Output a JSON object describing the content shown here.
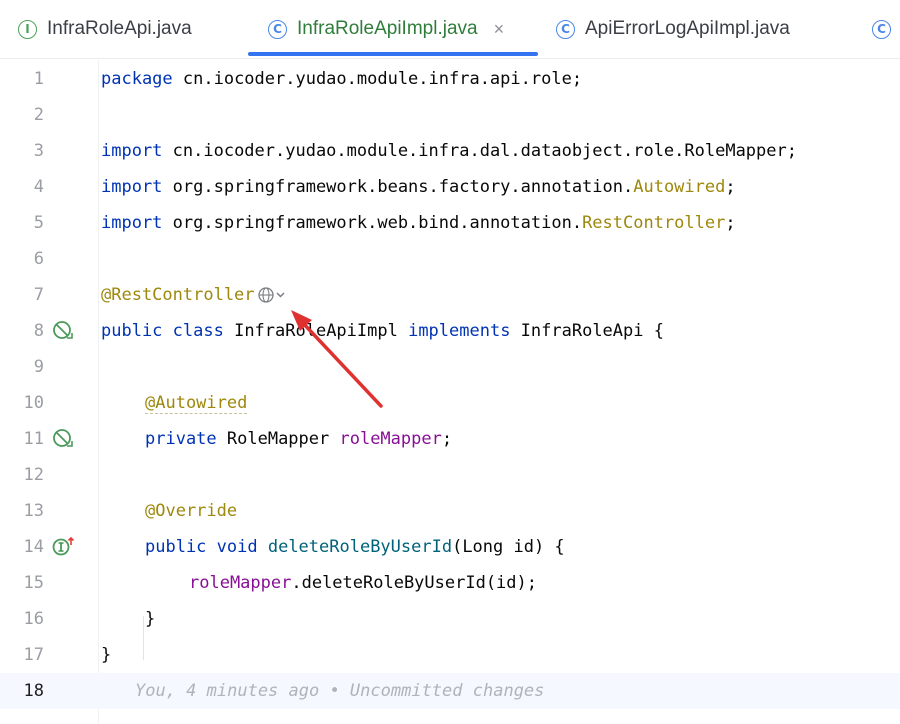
{
  "tabs": [
    {
      "label": "InfraRoleApi.java",
      "icon": "interface-icon",
      "icon_glyph": "I",
      "active": false
    },
    {
      "label": "InfraRoleApiImpl.java",
      "icon": "class-icon",
      "icon_glyph": "C",
      "active": true,
      "close": "×"
    },
    {
      "label": "ApiErrorLogApiImpl.java",
      "icon": "class-icon",
      "icon_glyph": "C",
      "active": false
    },
    {
      "label": "",
      "icon": "class-icon",
      "icon_glyph": "C",
      "active": false
    }
  ],
  "colors": {
    "keyword": "#0033b3",
    "annotation": "#9e880d",
    "field": "#871094",
    "method": "#00627a",
    "accent": "#3574f0"
  },
  "editor": {
    "line_numbers": [
      "1",
      "2",
      "3",
      "4",
      "5",
      "6",
      "7",
      "8",
      "9",
      "10",
      "11",
      "12",
      "13",
      "14",
      "15",
      "16",
      "17",
      "18"
    ],
    "current_line": "18",
    "lines": {
      "l1_kw": "package",
      "l1_rest": " cn.iocoder.yudao.module.infra.api.role;",
      "l3_kw": "import",
      "l3_rest": " cn.iocoder.yudao.module.infra.dal.dataobject.role.RoleMapper;",
      "l4_kw": "import",
      "l4_rest": " org.springframework.beans.factory.annotation.",
      "l4_ann": "Autowired",
      "l4_end": ";",
      "l5_kw": "import",
      "l5_rest": " org.springframework.web.bind.annotation.",
      "l5_ann": "RestController",
      "l5_end": ";",
      "l7_ann": "@RestController",
      "l8_kw1": "public",
      "l8_kw2": " class",
      "l8_name": " InfraRoleApiImpl ",
      "l8_kw3": "implements",
      "l8_rest": " InfraRoleApi {",
      "l10_ann": "@Autowired",
      "l11_kw": "private",
      "l11_type": " RoleMapper ",
      "l11_field": "roleMapper",
      "l11_end": ";",
      "l13_ann": "@Override",
      "l14_kw1": "public",
      "l14_kw2": " void ",
      "l14_method": "deleteRoleByUserId",
      "l14_rest": "(Long id) {",
      "l15_field": "roleMapper",
      "l15_rest": ".deleteRoleByUserId(id);",
      "l16": "}",
      "l17": "}",
      "l18_hint": "You, 4 minutes ago • Uncommitted changes"
    }
  }
}
